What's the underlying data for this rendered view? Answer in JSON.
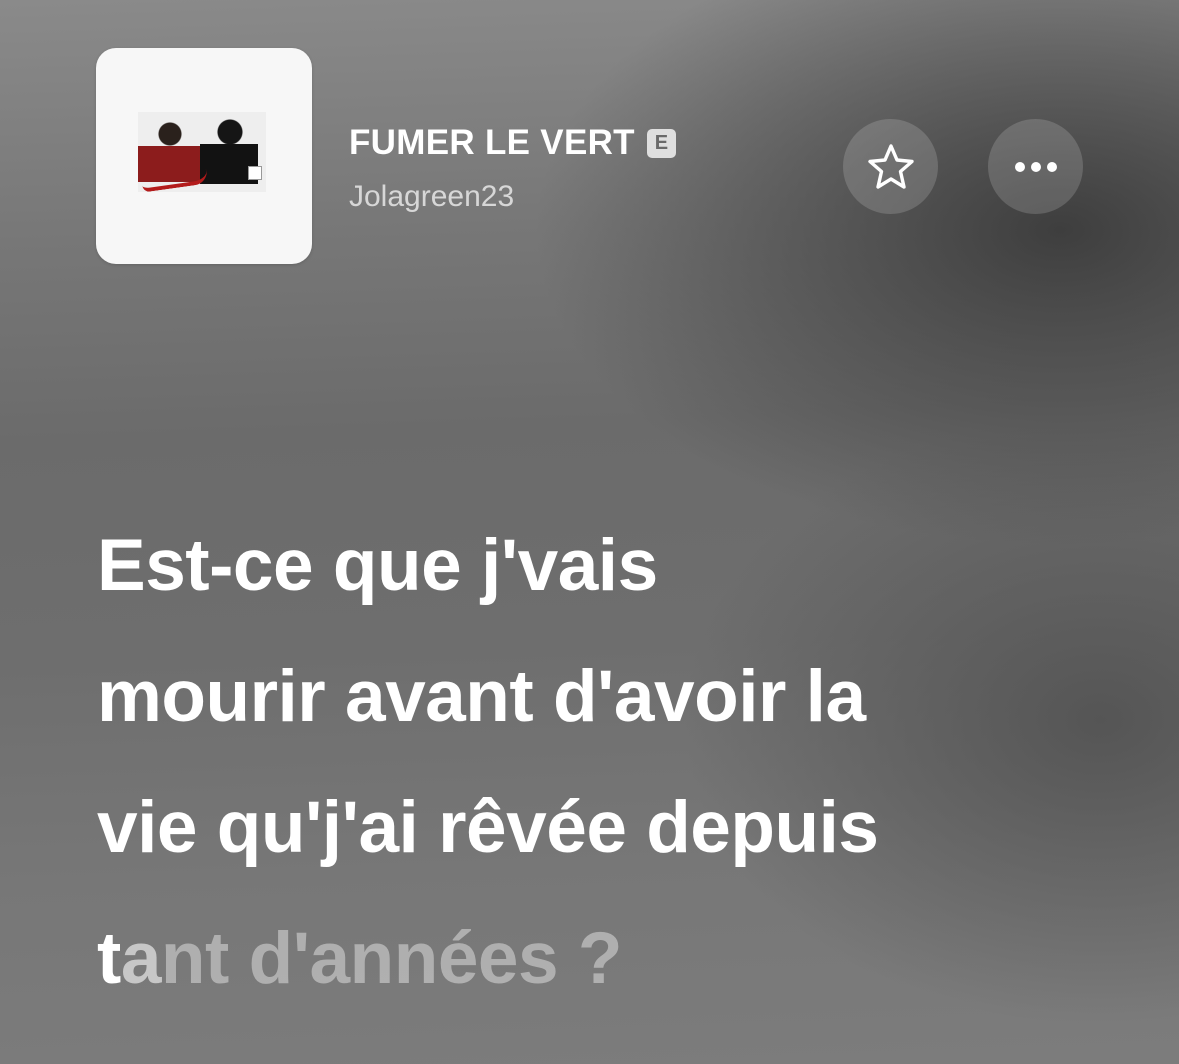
{
  "track": {
    "title": "FUMER LE VERT",
    "explicit_badge": "E",
    "artist": "Jolagreen23"
  },
  "actions": {
    "favorite_icon": "star-icon",
    "more_icon": "ellipsis-icon"
  },
  "lyrics": {
    "lines": [
      "Est-ce que j'vais",
      "mourir avant d'avoir la",
      "vie qu'j'ai rêvée depuis"
    ],
    "current_line": {
      "sung": "t",
      "fading": "a",
      "unsung": "nt d'années ?"
    }
  },
  "colors": {
    "text_primary": "#ffffff",
    "text_unsung": "#c8c8c8",
    "background": "#6e6e6e"
  }
}
